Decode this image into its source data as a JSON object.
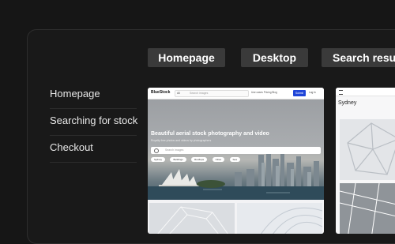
{
  "tabs": [
    "Homepage",
    "Desktop",
    "Search results"
  ],
  "menu": [
    "Homepage",
    "Searching for stock",
    "Checkout"
  ],
  "preview": {
    "logo": "BlueStock",
    "search_scope": "All",
    "search_placeholder": "Search images",
    "nav_links": "Use cases   Pricing   Blog",
    "submit_label": "Submit",
    "login_label": "Log in",
    "hero_title": "Beautiful aerial stock photography and video",
    "hero_subtitle": "Royalty free photos and videos by photographers",
    "hero_search_placeholder": "Search images",
    "tags": [
      "Sydney",
      "Buildings",
      "Rooftops",
      "Cities",
      "Sea"
    ]
  },
  "preview2": {
    "title": "Sydney"
  },
  "colors": {
    "background": "#161616",
    "chip": "#3a3a3a",
    "accent": "#1f45d8"
  }
}
